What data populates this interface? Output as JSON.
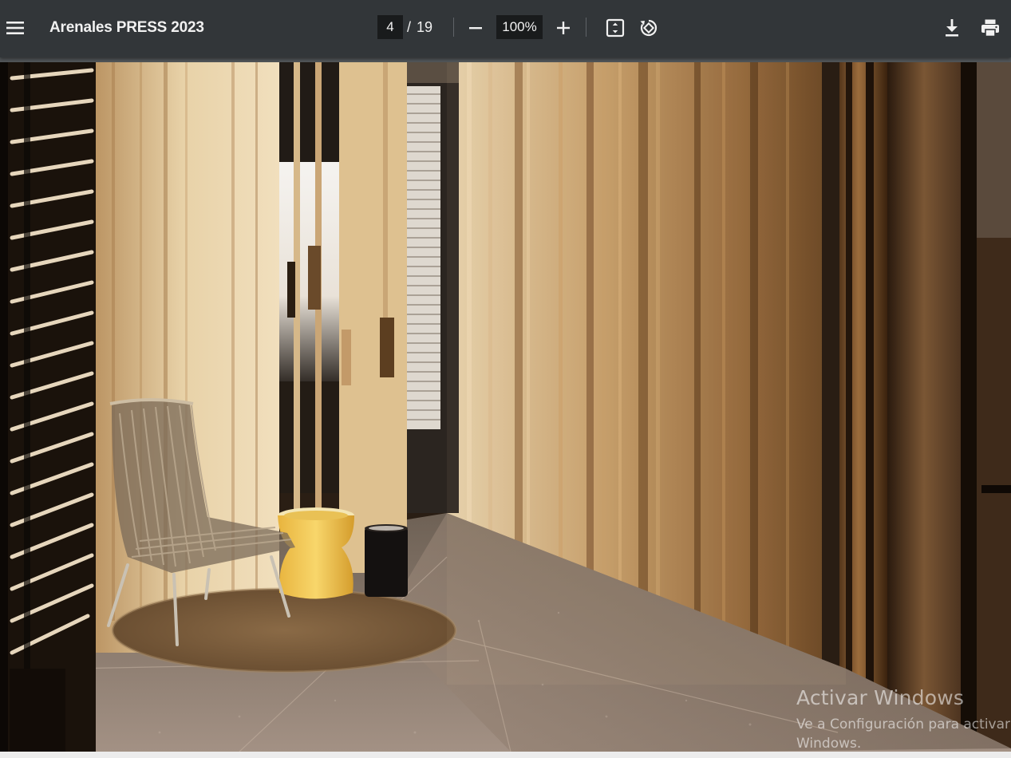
{
  "toolbar": {
    "menu_icon": "hamburger-menu-icon",
    "title": "Arenales PRESS 2023",
    "page_current": "4",
    "page_separator": "/",
    "page_total": "19",
    "zoom_out_icon": "minus-icon",
    "zoom_level": "100%",
    "zoom_in_icon": "plus-icon",
    "fit_icon": "fit-to-page-icon",
    "rotate_icon": "rotate-icon",
    "download_icon": "download-icon",
    "print_icon": "print-icon"
  },
  "watermark": {
    "title": "Activar Windows",
    "subtitle": "Ve a Configuración para activar",
    "subtitle_cont": "Windows."
  },
  "colors": {
    "toolbar_bg": "#323639",
    "page_bg": "#525659",
    "input_bg": "#191b1c",
    "text": "#f1f1f1"
  }
}
